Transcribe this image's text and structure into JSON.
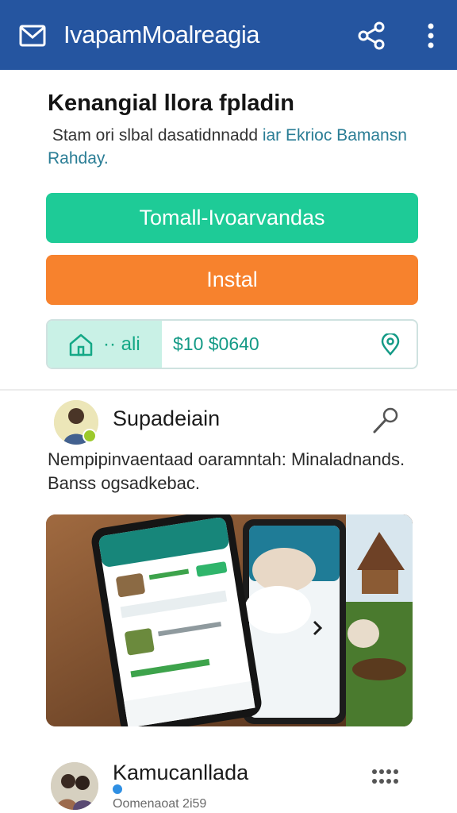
{
  "appbar": {
    "title": "IvapamMoalreagia",
    "icons": {
      "left": "mail-icon",
      "share": "share-icon",
      "more": "more-vertical-icon"
    }
  },
  "card": {
    "title": "Kenangial llora fpladin",
    "description_plain": "⁠ Stam ori slbal dasatidnnadd",
    "description_teal": " iar Ekrioc Bamansn Rahday.",
    "primary_button": "Tomall-Ivoarvandas",
    "secondary_button": "Instal",
    "segment_label": "·· ali",
    "price": "$10 $0640"
  },
  "post": {
    "author": "Supadeiain",
    "text": "Nempipinvaentaad oaramntah: Minaladnands. Banss ogsadkebac."
  },
  "next_post": {
    "author": "Kamucanllada",
    "meta": "Oomenaoat 2i59"
  },
  "colors": {
    "appbar": "#2555a0",
    "primary": "#1ecb97",
    "secondary": "#f7822d",
    "teal_text": "#149a86"
  }
}
